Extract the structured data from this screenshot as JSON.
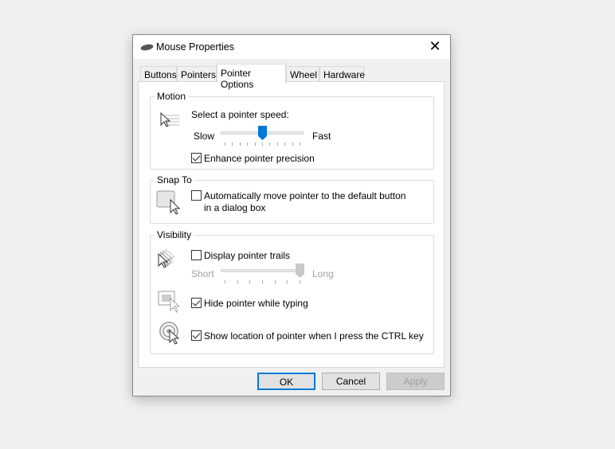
{
  "window": {
    "title": "Mouse Properties",
    "close_icon": "close-icon"
  },
  "tabs": [
    {
      "label": "Buttons"
    },
    {
      "label": "Pointers"
    },
    {
      "label": "Pointer Options",
      "active": true
    },
    {
      "label": "Wheel"
    },
    {
      "label": "Hardware"
    }
  ],
  "motion": {
    "group": "Motion",
    "speed_label": "Select a pointer speed:",
    "slow": "Slow",
    "fast": "Fast",
    "speed_value": 6,
    "speed_max": 11,
    "precision_label": "Enhance pointer precision",
    "precision_checked": true
  },
  "snap": {
    "group": "Snap To",
    "label": "Automatically move pointer to the default button in a dialog box",
    "checked": false
  },
  "visibility": {
    "group": "Visibility",
    "trails_label": "Display pointer trails",
    "trails_checked": false,
    "short": "Short",
    "long": "Long",
    "trails_value": 7,
    "trails_max": 7,
    "hide_label": "Hide pointer while typing",
    "hide_checked": true,
    "ctrl_label": "Show location of pointer when I press the CTRL key",
    "ctrl_checked": true
  },
  "buttons": {
    "ok": "OK",
    "cancel": "Cancel",
    "apply": "Apply"
  },
  "colors": {
    "accent": "#0078d7"
  }
}
